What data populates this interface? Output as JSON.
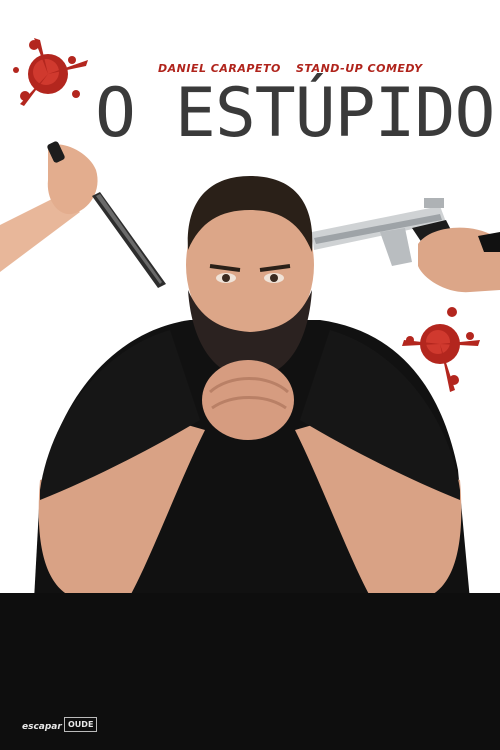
{
  "poster": {
    "performer": "DANIEL CARAPETO",
    "genre": "STAND-UP COMEDY",
    "title": "O ESTÚPIDO"
  },
  "footer": {
    "logo_left": "escapar",
    "logo_right": "OUDE"
  },
  "colors": {
    "accent": "#b0241c",
    "title": "#3a3a3a",
    "background": "#ffffff",
    "table": "#0e0e0e"
  }
}
